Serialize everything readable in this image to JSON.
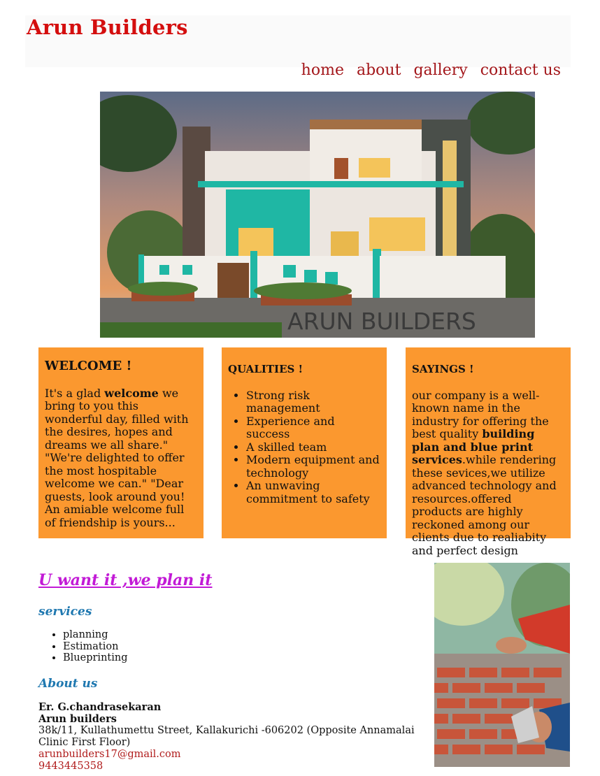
{
  "brand": "Arun Builders",
  "nav": [
    "home",
    "about",
    "gallery",
    "contact us"
  ],
  "hero": {
    "watermark": "ARUN BUILDERS"
  },
  "cards": {
    "welcome": {
      "title": "WELCOME !",
      "text_before": "It's a glad ",
      "text_bold": "welcome",
      "text_after": " we bring to you this wonderful day, filled with the desires, hopes and dreams we all share.\" \"We're delighted to offer the most hospitable welcome we can.\" \"Dear guests, look around you! An amiable welcome full of friendship is yours..."
    },
    "qualities": {
      "title": "QUALITIES !",
      "items": [
        "Strong risk management",
        "Experience and success",
        "A skilled team",
        "Modern equipment and technology",
        "An unwaving commitment to safety"
      ]
    },
    "sayings": {
      "title": "SAYINGS !",
      "text_before": "our company is a well-known name in the industry for offering the best quality ",
      "text_bold": "building plan and blue print services",
      "text_after": ".while rendering these sevices,we utilize advanced technology and resources.offered products are highly reckoned among our clients due to realiabity and perfect design"
    }
  },
  "tagline": "U want it ,we plan it",
  "services": {
    "heading": "services",
    "items": [
      "planning",
      "Estimation",
      "Blueprinting"
    ]
  },
  "about": {
    "heading": "About us",
    "name": "Er. G.chandrasekaran",
    "company": "Arun builders",
    "address": "38k/11, Kullathumettu Street, Kallakurichi -606202 (Opposite Annamalai Clinic First Floor)",
    "email": "arunbuilders17@gmail.com",
    "phone": "9443445358"
  },
  "colors": {
    "brand": "#d40e0e",
    "nav": "#a3171b",
    "card": "#fb982f",
    "tagline": "#c21ad6",
    "subheading": "#1f78b0",
    "contact": "#b01b1b"
  }
}
